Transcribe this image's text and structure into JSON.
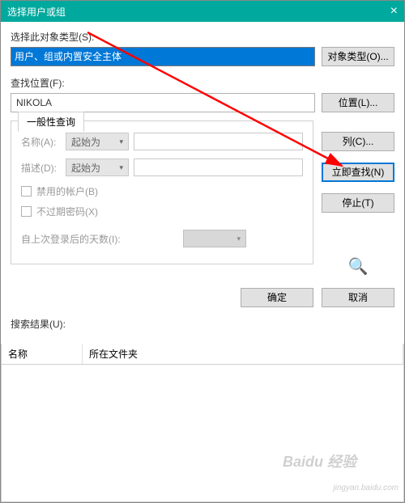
{
  "titlebar": {
    "title": "选择用户或组",
    "close": "×"
  },
  "sections": {
    "objtype_label": "选择此对象类型(S):",
    "objtype_value": "用户、组或内置安全主体",
    "objtype_btn": "对象类型(O)...",
    "location_label": "查找位置(F):",
    "location_value": "NIKOLA",
    "location_btn": "位置(L)..."
  },
  "tab": {
    "label": "一般性查询"
  },
  "form": {
    "name_label": "名称(A):",
    "name_mode": "起始为",
    "desc_label": "描述(D):",
    "desc_mode": "起始为",
    "chk_disabled": "禁用的帐户(B)",
    "chk_neverexpire": "不过期密码(X)",
    "lastlogin_label": "自上次登录后的天数(I):"
  },
  "right_buttons": {
    "columns": "列(C)...",
    "findnow": "立即查找(N)",
    "stop": "停止(T)"
  },
  "bottom": {
    "ok": "确定",
    "cancel": "取消"
  },
  "results": {
    "label": "搜索结果(U):",
    "col1": "名称",
    "col2": "所在文件夹"
  },
  "watermark": "jingyan.baidu.com",
  "logo": "Baidu 经验"
}
